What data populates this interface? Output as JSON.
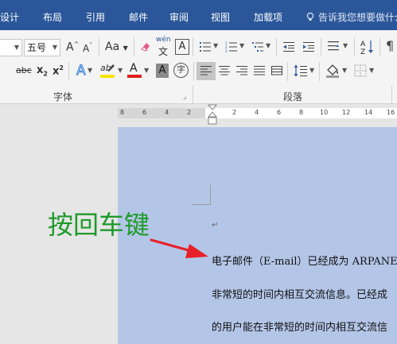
{
  "tabs": [
    "设计",
    "布局",
    "引用",
    "邮件",
    "审阅",
    "视图",
    "加载项"
  ],
  "tell_me": "告诉我您想要做什么",
  "ribbon": {
    "font_size_value": "五号",
    "grow_font": "A",
    "shrink_font": "A",
    "change_case": "Aa",
    "phonetic_top": "wén",
    "phonetic_bottom": "文",
    "char_border": "A",
    "strikethrough": "abc",
    "subscript": "x",
    "subscript_num": "2",
    "superscript": "x",
    "superscript_num": "2",
    "text_effect": "A",
    "highlight_letters": "ab",
    "font_color_letter": "A",
    "char_shading": "A",
    "enclosed_char": "字",
    "font_group": "字体",
    "paragraph_group": "段落"
  },
  "ruler_numbers": [
    "8",
    "6",
    "4",
    "2",
    "2",
    "4",
    "6",
    "8",
    "10",
    "12",
    "14",
    "16"
  ],
  "colors": {
    "tab_bar": "#2b579a",
    "page_selection": "#b4c6e7",
    "annotation": "#1e9a2a",
    "arrow": "#e8202a"
  },
  "document": {
    "paragraph_mark": "↵",
    "lines": [
      "电子邮件（E-mail）已经成为 ARPANET",
      "非常短的时间内相互交流信息。已经成",
      "的用户能在非常短的时间内相互交流信"
    ]
  },
  "annotation": {
    "text": "按回车键"
  }
}
